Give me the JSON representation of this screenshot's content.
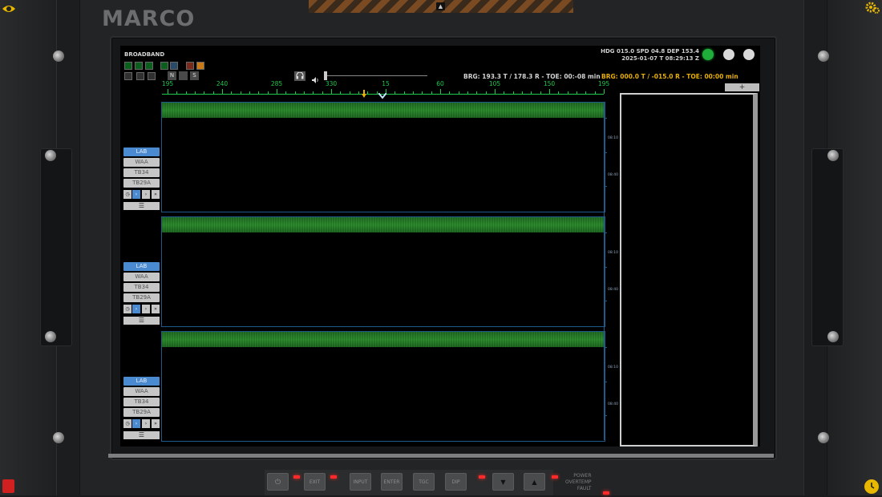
{
  "brand": "MARCO",
  "screen": {
    "title": "BROADBAND",
    "toolbar": {
      "btn_n": "N",
      "btn_s": "S"
    },
    "status": {
      "line1": "HDG 015.0  SPD 04.8  DEP 153.4",
      "line2": "2025-01-07 T 08:29:13 Z"
    },
    "bearing_readout": "BRG: 193.3 T / 178.3 R - TOE: 00:-08 min",
    "bearing_readout_alt": "BRG: 000.0 T / -015.0 R - TOE: 00:00 min",
    "scale_labels": [
      "195",
      "240",
      "285",
      "330",
      "15",
      "60",
      "105",
      "150",
      "195"
    ],
    "panels": [
      {
        "channels": [
          "LAB",
          "WAA",
          "TB34",
          "TB29A"
        ],
        "active": "LAB",
        "times": [
          "08:10",
          "08:40"
        ]
      },
      {
        "channels": [
          "LAB",
          "WAA",
          "TB34",
          "TB29A"
        ],
        "active": "LAB",
        "times": [
          "08:10",
          "08:40"
        ]
      },
      {
        "channels": [
          "LAB",
          "WAA",
          "TB34",
          "TB29A"
        ],
        "active": "LAB",
        "times": [
          "08:10",
          "08:40"
        ]
      }
    ],
    "menu_glyph": "☰",
    "plus_glyph": "+"
  },
  "hardware_buttons": {
    "power_glyph": "⏻",
    "exit": "EXIT",
    "input": "INPUT",
    "enter": "ENTER",
    "tgc": "TGC",
    "dip": "DIP",
    "down": "▼",
    "up": "▲",
    "power_label": "POWER",
    "overtemp_label": "OVERTEMP",
    "fault_label": "FAULT"
  },
  "hazard_glyph": "▲",
  "colors": {
    "scale_green": "#1ec84a",
    "panel_border": "#1e5a8c",
    "bearing_alt": "#e8b000",
    "led_green": "#1fae3a",
    "channel_active": "#4a8ad0"
  },
  "icons": {
    "top_left": "eye-icon",
    "top_right": "gear-icon",
    "bottom_left": "trash-icon",
    "bottom_right": "clock-icon"
  }
}
